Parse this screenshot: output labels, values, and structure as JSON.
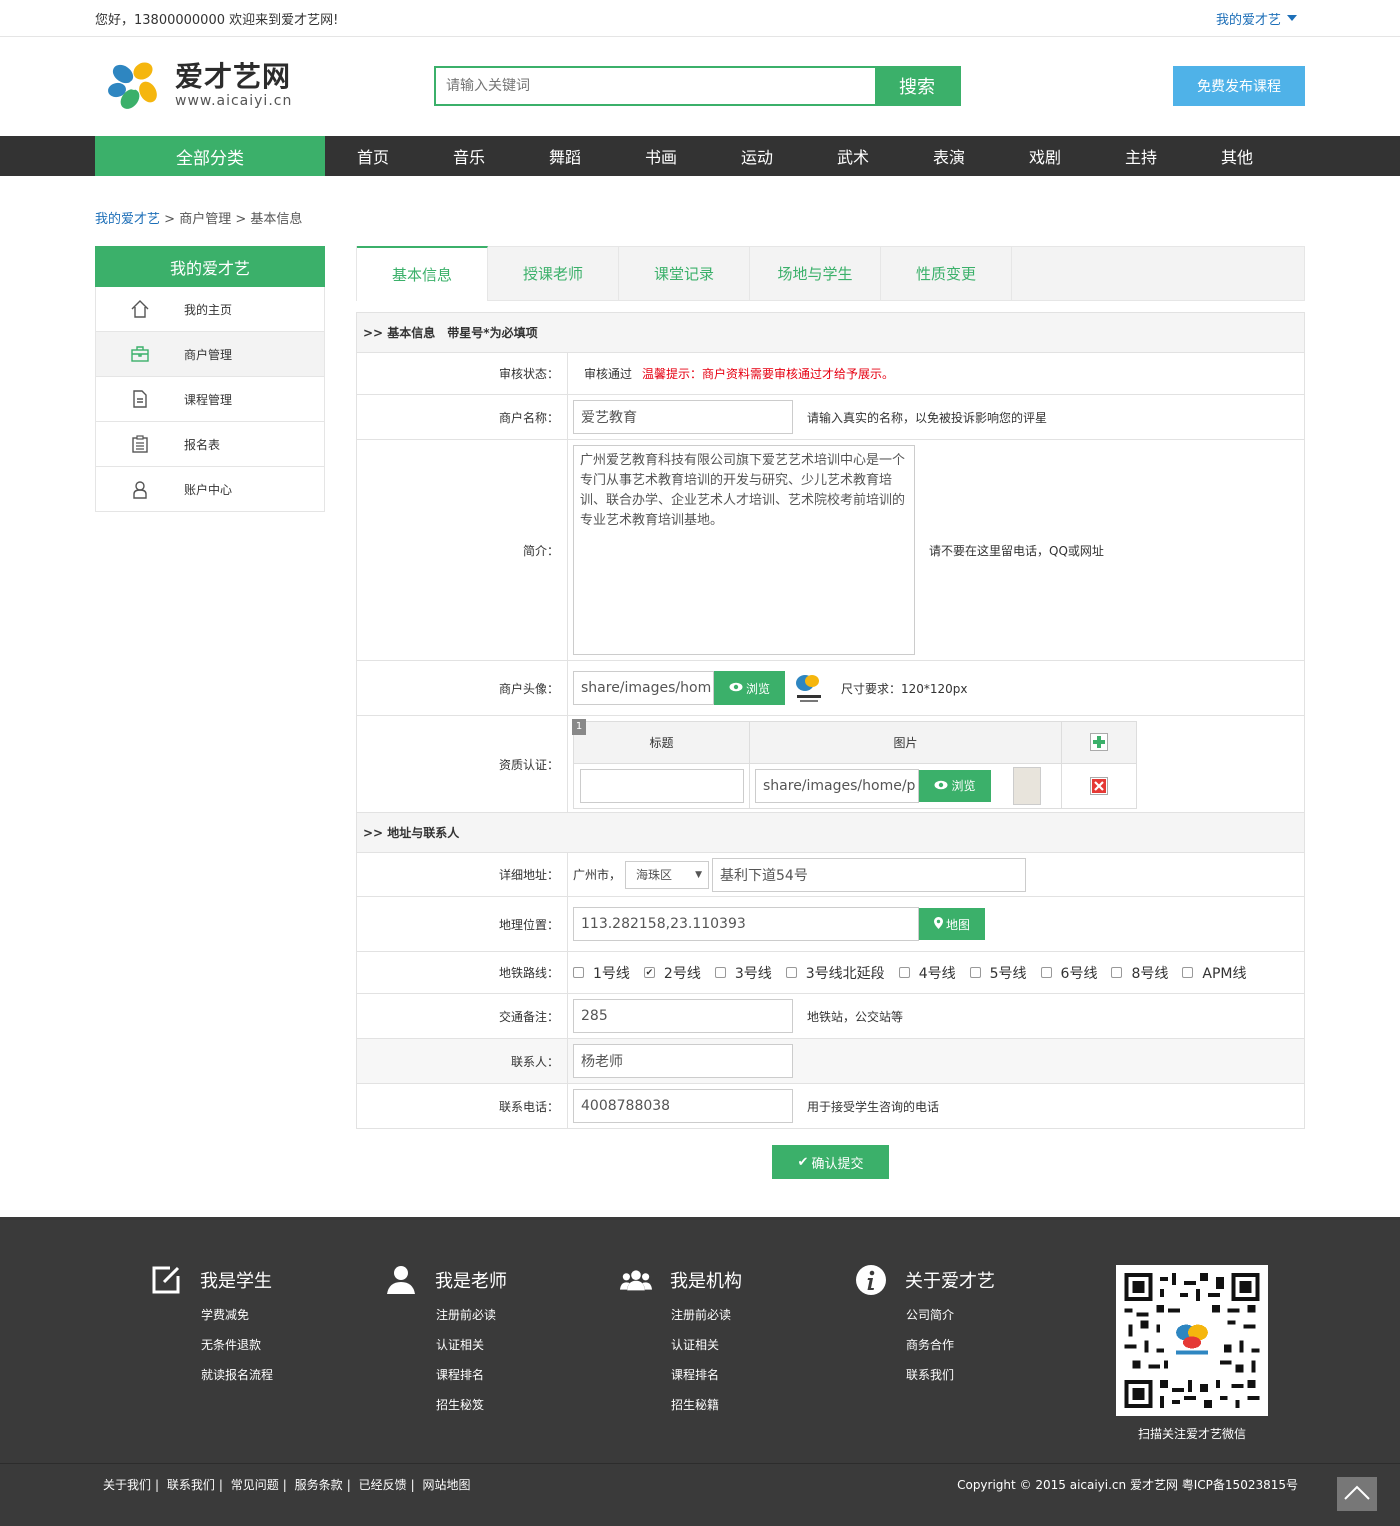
{
  "topbar": {
    "greeting": "您好，13800000000 欢迎来到爱才艺网!",
    "my_link": "我的爱才艺"
  },
  "header": {
    "logo_name": "爱才艺网",
    "logo_url": "www.aicaiyi.cn",
    "search_placeholder": "请输入关键词",
    "search_button": "搜索",
    "publish_button": "免费发布课程"
  },
  "nav": {
    "all_label": "全部分类",
    "items": [
      "首页",
      "音乐",
      "舞蹈",
      "书画",
      "运动",
      "武术",
      "表演",
      "戏剧",
      "主持",
      "其他"
    ]
  },
  "breadcrumb": {
    "home": "我的爱才艺",
    "sep1": " > ",
    "level2": "商户管理",
    "sep2": " > ",
    "current": "基本信息"
  },
  "sidebar": {
    "title": "我的爱才艺",
    "items": [
      {
        "label": "我的主页",
        "icon": "home-icon"
      },
      {
        "label": "商户管理",
        "icon": "briefcase-icon"
      },
      {
        "label": "课程管理",
        "icon": "document-icon"
      },
      {
        "label": "报名表",
        "icon": "clipboard-icon"
      },
      {
        "label": "账户中心",
        "icon": "user-icon"
      }
    ]
  },
  "tabs": [
    "基本信息",
    "授课老师",
    "课堂记录",
    "场地与学生",
    "性质变更"
  ],
  "form": {
    "section1": ">> 基本信息　带星号*为必填项",
    "status_label": "审核状态：",
    "status_value": "审核通过",
    "status_tip": "温馨提示：商户资料需要审核通过才给予展示。",
    "name_label": "商户名称：",
    "name_value": "爱艺教育",
    "name_hint": "请输入真实的名称，以免被投诉影响您的评星",
    "intro_label": "简介：",
    "intro_value": "广州爱艺教育科技有限公司旗下爱艺艺术培训中心是一个专门从事艺术教育培训的开发与研究、少儿艺术教育培训、联合办学、企业艺术人才培训、艺术院校考前培训的专业艺术教育培训基地。",
    "intro_hint": "请不要在这里留电话，QQ或网址",
    "avatar_label": "商户头像：",
    "avatar_value": "share/images/hom",
    "browse": "浏览",
    "avatar_hint": "尺寸要求：120*120px",
    "qual_label": "资质认证：",
    "qual_badge": "1",
    "qual_col_title": "标题",
    "qual_col_image": "图片",
    "qual_image_value": "share/images/home/p",
    "section2": ">> 地址与联系人",
    "addr_label": "详细地址：",
    "addr_city": "广州市，",
    "addr_district": "海珠区",
    "addr_street": "基利下道54号",
    "geo_label": "地理位置：",
    "geo_value": "113.282158,23.110393",
    "map_button": "地图",
    "metro_label": "地铁路线：",
    "metro_lines": [
      {
        "name": "1号线",
        "checked": false
      },
      {
        "name": "2号线",
        "checked": true
      },
      {
        "name": "3号线",
        "checked": false
      },
      {
        "name": "3号线北延段",
        "checked": false
      },
      {
        "name": "4号线",
        "checked": false
      },
      {
        "name": "5号线",
        "checked": false
      },
      {
        "name": "6号线",
        "checked": false
      },
      {
        "name": "8号线",
        "checked": false
      },
      {
        "name": "APM线",
        "checked": false
      }
    ],
    "traffic_label": "交通备注：",
    "traffic_value": "285",
    "traffic_hint": "地铁站，公交站等",
    "contact_label": "联系人：",
    "contact_value": "杨老师",
    "phone_label": "联系电话：",
    "phone_value": "4008788038",
    "phone_hint": "用于接受学生咨询的电话",
    "submit": "确认提交"
  },
  "footer": {
    "columns": [
      {
        "title": "我是学生",
        "icon": "edit-icon",
        "links": [
          "学费减免",
          "无条件退款",
          "就读报名流程"
        ]
      },
      {
        "title": "我是老师",
        "icon": "person-icon",
        "links": [
          "注册前必读",
          "认证相关",
          "课程排名",
          "招生秘笈"
        ]
      },
      {
        "title": "我是机构",
        "icon": "group-icon",
        "links": [
          "注册前必读",
          "认证相关",
          "课程排名",
          "招生秘籍"
        ]
      },
      {
        "title": "关于爱才艺",
        "icon": "info-icon",
        "links": [
          "公司简介",
          "商务合作",
          "联系我们"
        ]
      }
    ],
    "qr_caption": "扫描关注爱才艺微信",
    "bottom_links": [
      "关于我们",
      "联系我们",
      "常见问题",
      "服务条款",
      "已经反馈",
      "网站地图"
    ],
    "copyright": "Copyright © 2015 aicaiyi.cn 爱才艺网 粤ICP备15023815号"
  },
  "colors": {
    "accent": "#3bb06a",
    "link": "#1d6fb8",
    "publish": "#4fb2e8",
    "nav_bg": "#333333",
    "footer_bg": "#3a3a3a",
    "warn": "#e60012"
  }
}
